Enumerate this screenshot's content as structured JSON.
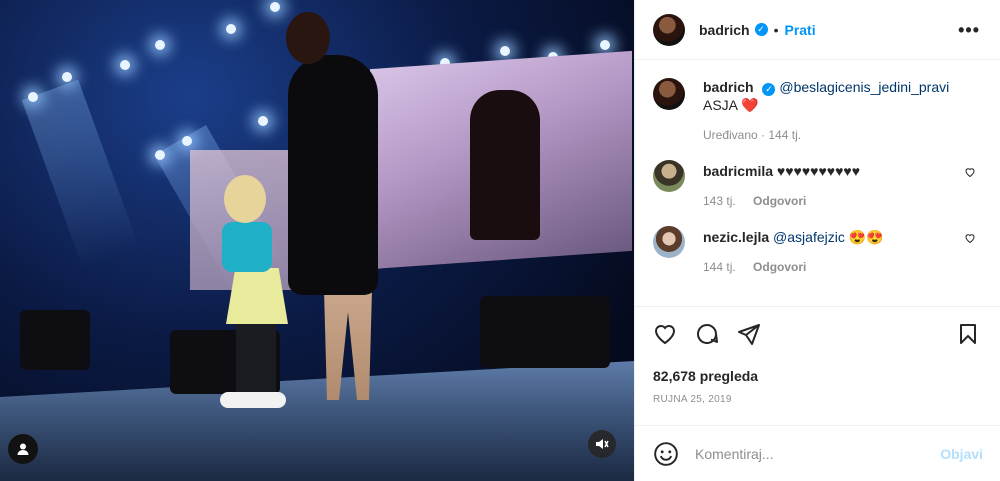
{
  "post": {
    "author": "badrich",
    "follow_label": "Prati",
    "dot": "•",
    "more_label": "•••"
  },
  "caption": {
    "author": "badrich",
    "mention": "@beslagicenis_jedini_pravi",
    "text": "ASJA",
    "heart": "❤️",
    "meta_edited": "Uređivano",
    "meta_sep": " · ",
    "meta_age": "144 tj."
  },
  "comments": [
    {
      "user": "badricmila",
      "text": "♥♥♥♥♥♥♥♥♥♥",
      "age": "143 tj.",
      "reply": "Odgovori"
    },
    {
      "user": "nezic.lejla",
      "mention": "@asjafejzic",
      "text": "😍😍",
      "age": "144 tj.",
      "reply": "Odgovori"
    }
  ],
  "stats": {
    "views": "82,678 pregleda",
    "date": "RUJNA 25, 2019"
  },
  "composer": {
    "placeholder": "Komentiraj...",
    "post_label": "Objavi"
  },
  "icons": {
    "like": "heart-outline-icon",
    "comment": "comment-bubble-icon",
    "share": "paper-plane-icon",
    "save": "bookmark-icon",
    "emoji": "smiley-icon",
    "mute": "speaker-muted-icon",
    "tagged": "user-tag-icon",
    "verified": "verified-badge-icon"
  },
  "colors": {
    "accent": "#0095f6",
    "mention": "#00376b",
    "muted": "#8e8e8e",
    "post_disabled": "#b2dffc"
  }
}
